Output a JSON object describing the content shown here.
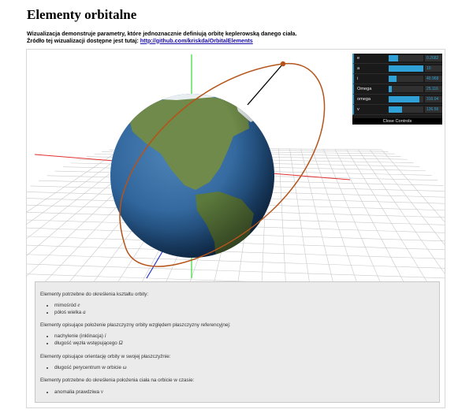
{
  "page": {
    "title": "Elementy orbitalne",
    "intro_line1": "Wizualizacja demonstruje parametry, które jednoznacznie definiują orbitę keplerowską danego ciała.",
    "intro_line2_prefix": "Źródło tej wizualizacji dostępne jest tutaj: ",
    "source_link": "http://github.com/kriskda/OrbitalElements"
  },
  "controls": {
    "rows": [
      {
        "label": "e",
        "value": "0.2682",
        "fill": 0.27
      },
      {
        "label": "a",
        "value": "10",
        "fill": 1.0
      },
      {
        "label": "i",
        "value": "40.968",
        "fill": 0.23
      },
      {
        "label": "Omega",
        "value": "25.116",
        "fill": 0.1
      },
      {
        "label": "omega",
        "value": "316.04",
        "fill": 0.88
      },
      {
        "label": "v",
        "value": "136.56",
        "fill": 0.38
      }
    ],
    "close_label": "Close Controls"
  },
  "info": {
    "shape_heading": "Elementy potrzebne do określenia kształtu orbity:",
    "shape_items": [
      {
        "text": "mimośród ",
        "symbol": "e"
      },
      {
        "text": "półoś wielka ",
        "symbol": "a"
      }
    ],
    "plane_heading": "Elementy opisujące położenie płaszczyzny orbity względem płaszczyzny referencyjnej:",
    "plane_items": [
      {
        "text": "nachylenie (inklinacja) ",
        "symbol": "i"
      },
      {
        "text": "długość węzła wstępującego ",
        "symbol": "Ω"
      }
    ],
    "orient_heading": "Elementy opisujące orientację orbity w swojej płaszczyźnie:",
    "orient_items": [
      {
        "text": "długość perycentrum w orbicie ",
        "symbol": "ω"
      }
    ],
    "position_heading": "Elementy potrzebne do określenia położenia ciała na orbicie w czasie:",
    "position_items": [
      {
        "text": "anomalia prawdziwa ",
        "symbol": "ν"
      }
    ]
  },
  "colors": {
    "orbit": "#b5541a",
    "axis_x": "#e03030",
    "axis_y": "#33dd33",
    "axis_z": "#2233cc",
    "grid": "#c9c9c9",
    "ocean": "#2a5f96",
    "land": "#6f8a4a",
    "gui_accent": "#2fa1d6"
  }
}
